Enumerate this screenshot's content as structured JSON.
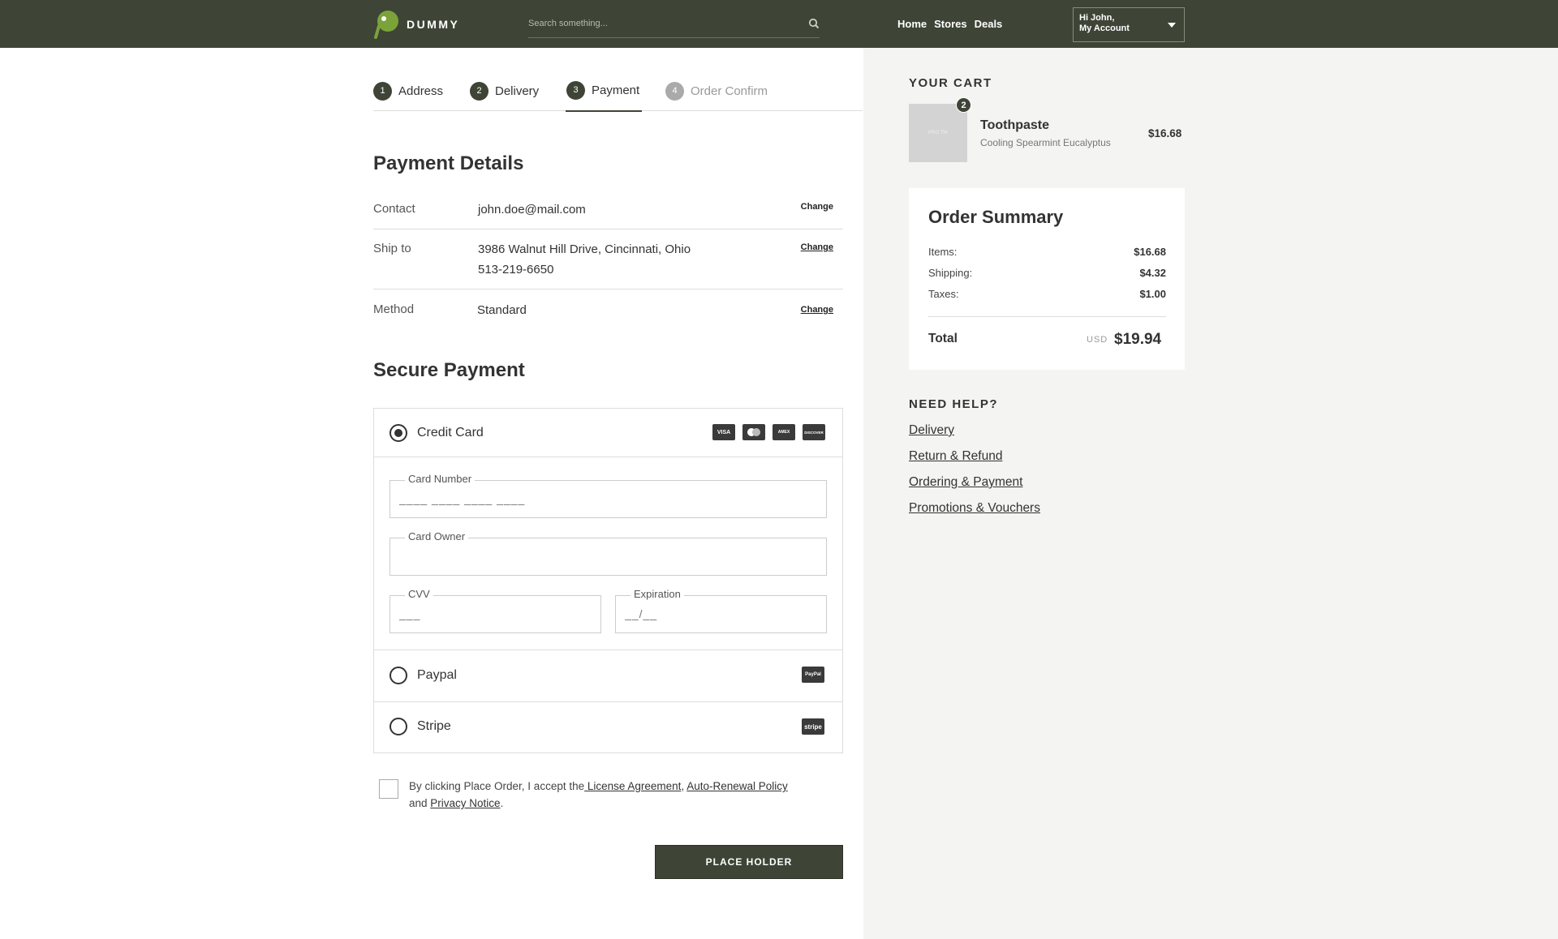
{
  "header": {
    "brand": "DUMMY",
    "search_placeholder": "Search something...",
    "nav": [
      "Home",
      "Stores",
      "Deals"
    ],
    "account_line1": "Hi John,",
    "account_line2": "My Account"
  },
  "steps": [
    {
      "num": "1",
      "label": "Address"
    },
    {
      "num": "2",
      "label": "Delivery"
    },
    {
      "num": "3",
      "label": "Payment"
    },
    {
      "num": "4",
      "label": "Order Confirm"
    }
  ],
  "payment_details": {
    "title": "Payment Details",
    "contact_label": "Contact",
    "contact_value": "john.doe@mail.com",
    "ship_label": "Ship to",
    "ship_value_line1": "3986 Walnut Hill Drive, Cincinnati, Ohio",
    "ship_value_line2": "513-219-6650",
    "method_label": "Method",
    "method_value": "Standard",
    "change_label": "Change"
  },
  "secure_payment": {
    "title": "Secure Payment",
    "credit_card_label": "Credit Card",
    "card_icons": [
      "VISA",
      "MC",
      "AMEX",
      "DISCOVER"
    ],
    "card_number_label": "Card Number",
    "card_number_placeholder": "____ ____ ____ ____",
    "card_owner_label": "Card Owner",
    "card_owner_placeholder": "",
    "cvv_label": "CVV",
    "cvv_placeholder": "___",
    "expiration_label": "Expiration",
    "expiration_placeholder": "__/__",
    "paypal_label": "Paypal",
    "paypal_icon": "PayPal",
    "stripe_label": "Stripe",
    "stripe_icon": "stripe"
  },
  "agreement": {
    "text_before": "By clicking Place Order, I accept the",
    "license": " License Agreement",
    "comma": ", ",
    "auto_renewal": "Auto-Renewal Policy",
    "and": "and ",
    "privacy": "Privacy Notice",
    "period": "."
  },
  "place_button": "PLACE HOLDER",
  "cart": {
    "title": "YOUR CART",
    "thumb_text": "PRO 7W",
    "qty": "2",
    "item_name": "Toothpaste",
    "item_variant": "Cooling Spearmint Eucalyptus",
    "item_price": "$16.68"
  },
  "summary": {
    "title": "Order Summary",
    "items_label": "Items:",
    "items_value": "$16.68",
    "shipping_label": "Shipping:",
    "shipping_value": "$4.32",
    "taxes_label": "Taxes:",
    "taxes_value": "$1.00",
    "total_label": "Total",
    "currency": "USD",
    "total_value": "$19.94"
  },
  "help": {
    "title": "NEED HELP?",
    "links": [
      "Delivery",
      "Return & Refund",
      "Ordering & Payment",
      "Promotions & Vouchers"
    ]
  },
  "colors": {
    "header_bg": "#3e4436",
    "accent_green": "#7ba33a",
    "panel_bg": "#f4f4f2"
  }
}
